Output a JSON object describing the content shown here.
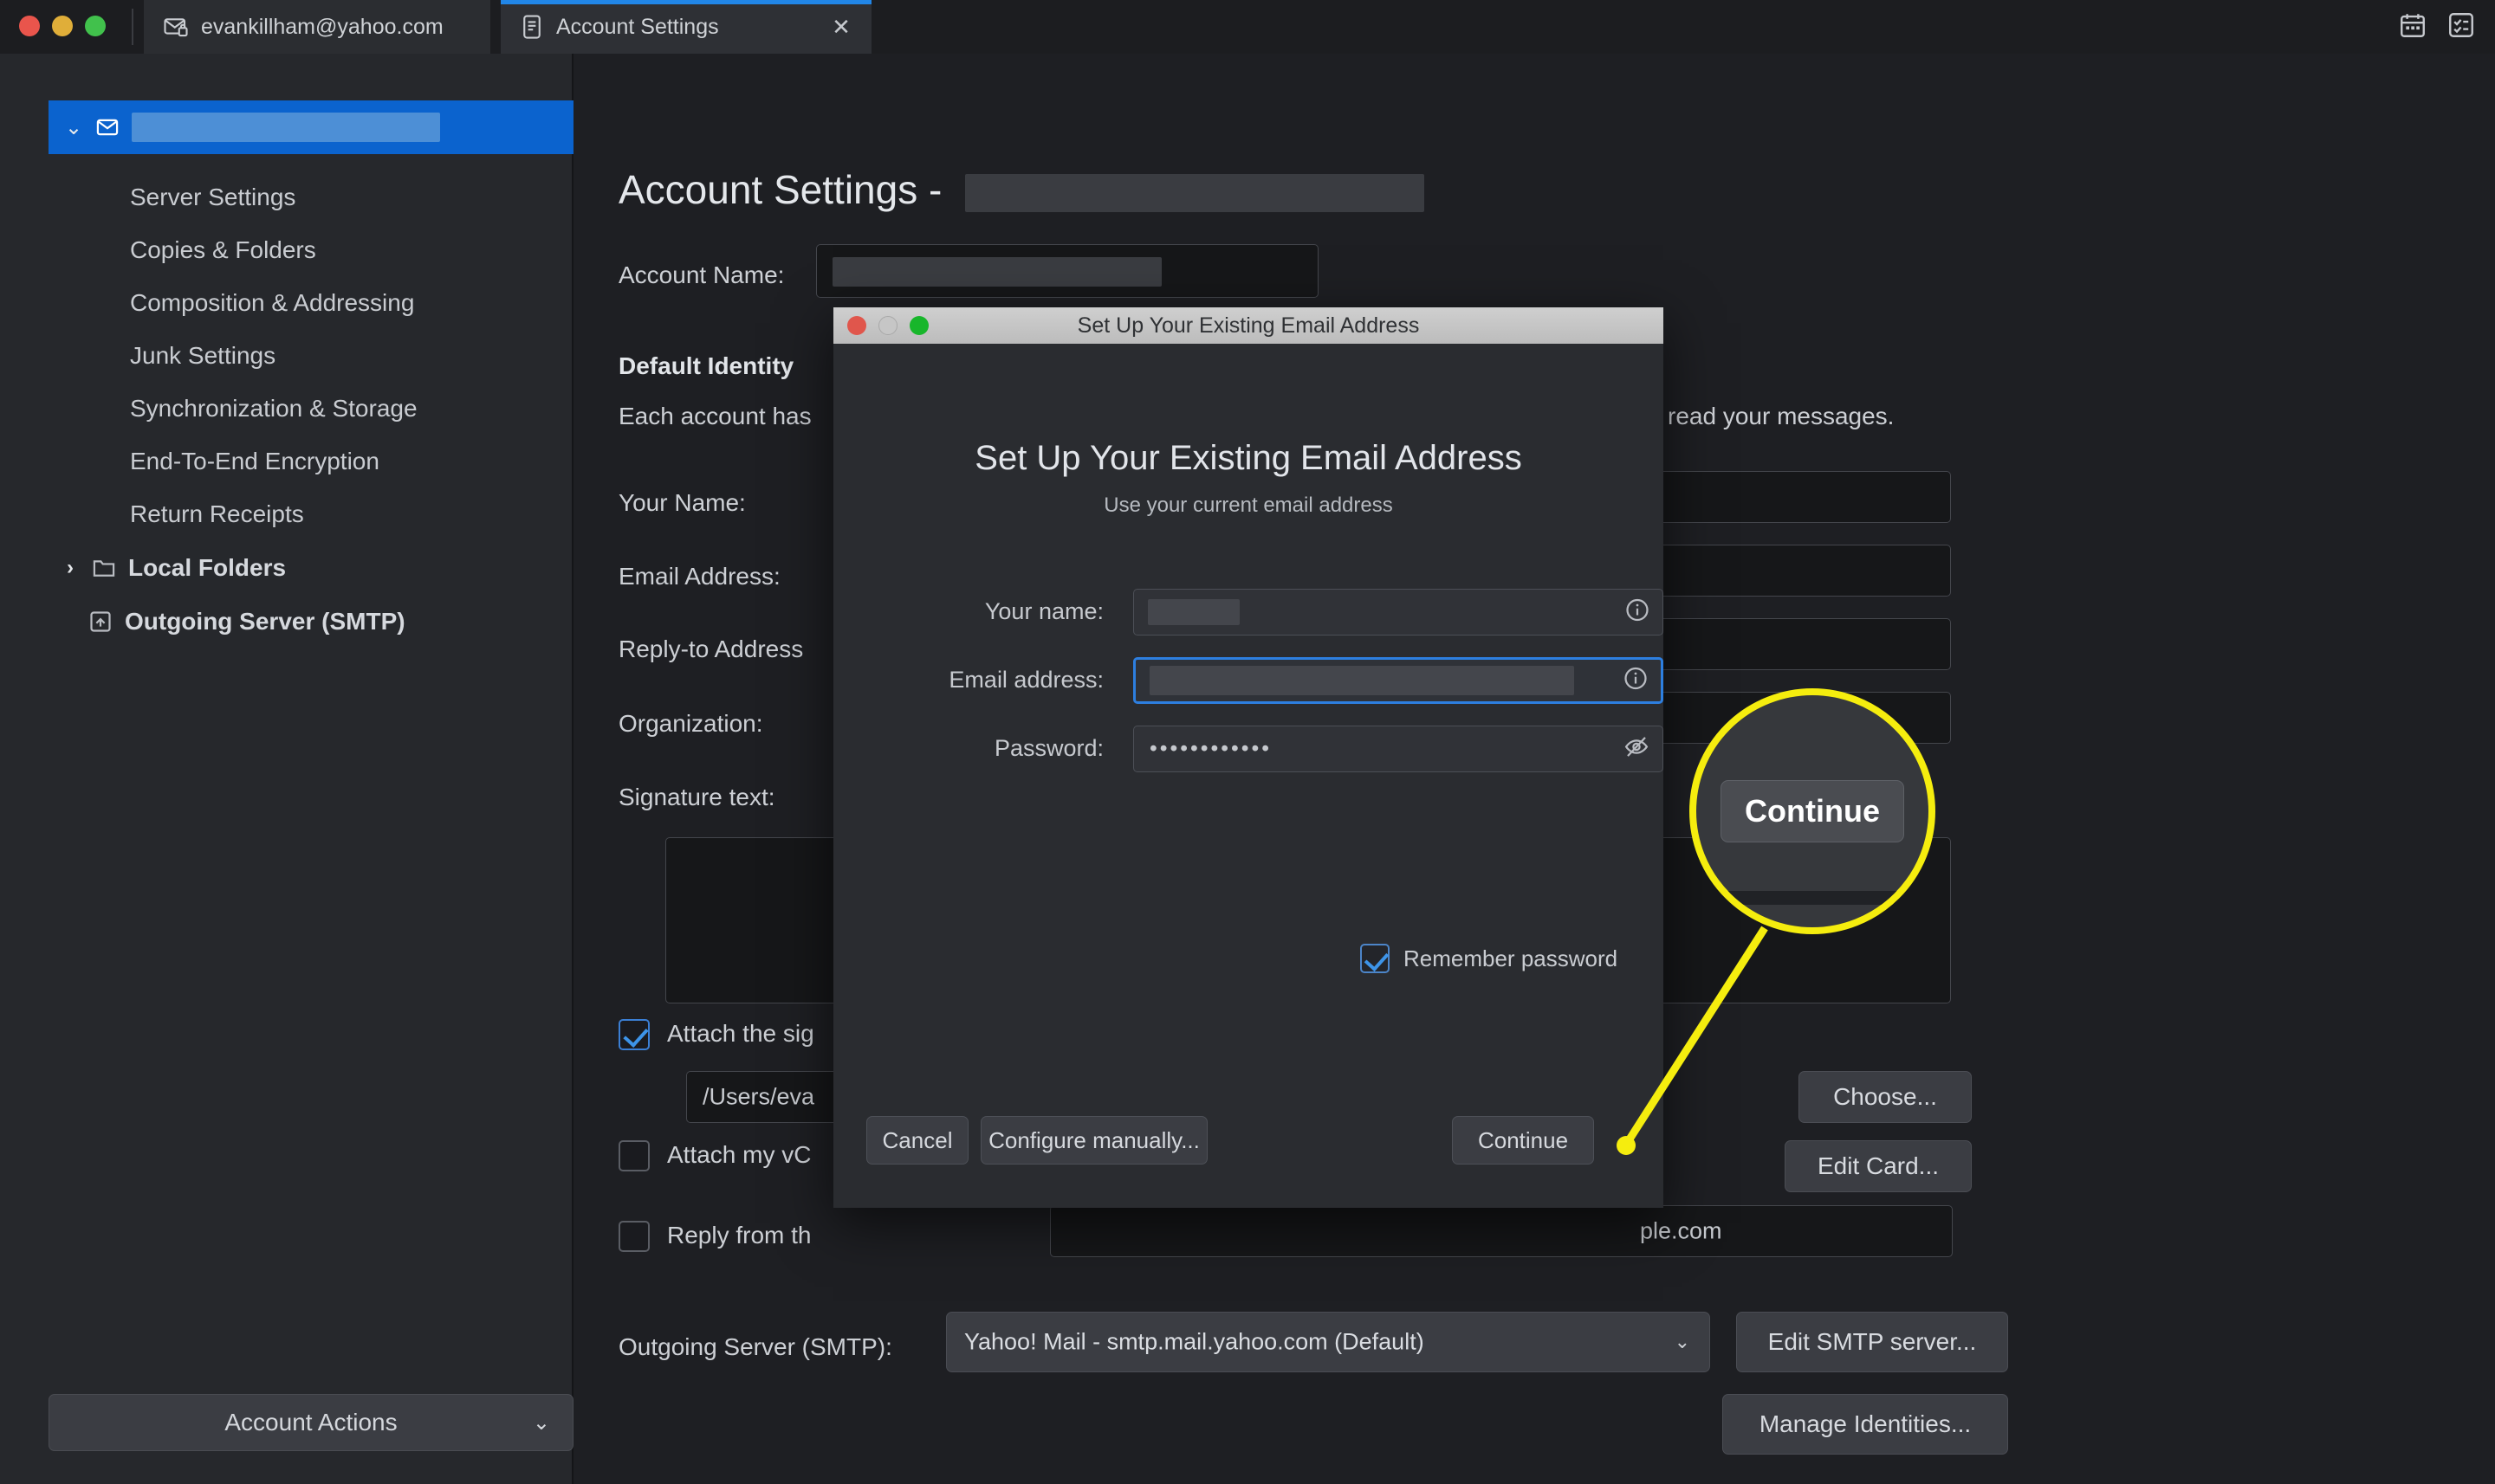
{
  "window": {
    "traffic_lights": [
      "close",
      "minimize",
      "maximize"
    ],
    "tabs": [
      {
        "icon": "mail-lock-icon",
        "label": "evankillham@yahoo.com",
        "active": false
      },
      {
        "icon": "document-icon",
        "label": "Account Settings",
        "active": true,
        "close_label": "✕"
      }
    ],
    "top_right_icons": [
      "calendar-icon",
      "tasks-icon"
    ]
  },
  "sidebar": {
    "account_row": {
      "twisty": "⌄",
      "icon": "mail-icon",
      "label_redacted": true
    },
    "items": [
      {
        "label": "Server Settings"
      },
      {
        "label": "Copies & Folders"
      },
      {
        "label": "Composition & Addressing"
      },
      {
        "label": "Junk Settings"
      },
      {
        "label": "Synchronization & Storage"
      },
      {
        "label": "End-To-End Encryption"
      },
      {
        "label": "Return Receipts"
      }
    ],
    "nodes": [
      {
        "twisty": "›",
        "icon": "folder-icon",
        "label": "Local Folders"
      },
      {
        "twisty": "",
        "icon": "smtp-icon",
        "label": "Outgoing Server (SMTP)"
      }
    ],
    "account_actions": {
      "label": "Account Actions",
      "chevron": "⌄"
    }
  },
  "main": {
    "page_title_prefix": "Account Settings -",
    "account_name_label": "Account Name:",
    "default_identity_heading": "Default Identity",
    "default_identity_desc_start": "Each account has",
    "default_identity_desc_end": "read your messages.",
    "fields": [
      {
        "label": "Your Name:"
      },
      {
        "label": "Email Address:"
      },
      {
        "label": "Reply-to Address"
      },
      {
        "label": "Organization:"
      },
      {
        "label": "Signature text:"
      }
    ],
    "checkbox_attach_signature": {
      "label": "Attach the sig",
      "checked": true
    },
    "signature_path": "/Users/eva",
    "checkbox_attach_vcard": {
      "label": "Attach my vC",
      "checked": false
    },
    "checkbox_reply_from": {
      "label": "Reply from th",
      "checked": false
    },
    "reply_from_tail": "ple.com",
    "choose_button": "Choose...",
    "edit_card_button": "Edit Card...",
    "smtp_label": "Outgoing Server (SMTP):",
    "smtp_value": "Yahoo! Mail - smtp.mail.yahoo.com (Default)",
    "smtp_chevron": "⌄",
    "edit_smtp_button": "Edit SMTP server...",
    "manage_identities_button": "Manage Identities..."
  },
  "dialog": {
    "titlebar_title": "Set Up Your Existing Email Address",
    "heading": "Set Up Your Existing Email Address",
    "subheading": "Use your current email address",
    "fields": [
      {
        "label": "Your name:",
        "value_redacted": true,
        "icon": "info-icon",
        "focused": false
      },
      {
        "label": "Email address:",
        "value_redacted": true,
        "icon": "info-icon",
        "focused": true
      },
      {
        "label": "Password:",
        "value": "••••••••••••",
        "icon": "eye-off-icon",
        "focused": false
      }
    ],
    "remember_password": {
      "label": "Remember password",
      "checked": true
    },
    "buttons": {
      "cancel": "Cancel",
      "configure_manually": "Configure manually...",
      "continue": "Continue"
    }
  },
  "callout": {
    "magnified_label": "Continue",
    "highlight_color": "#f5ed0e"
  }
}
